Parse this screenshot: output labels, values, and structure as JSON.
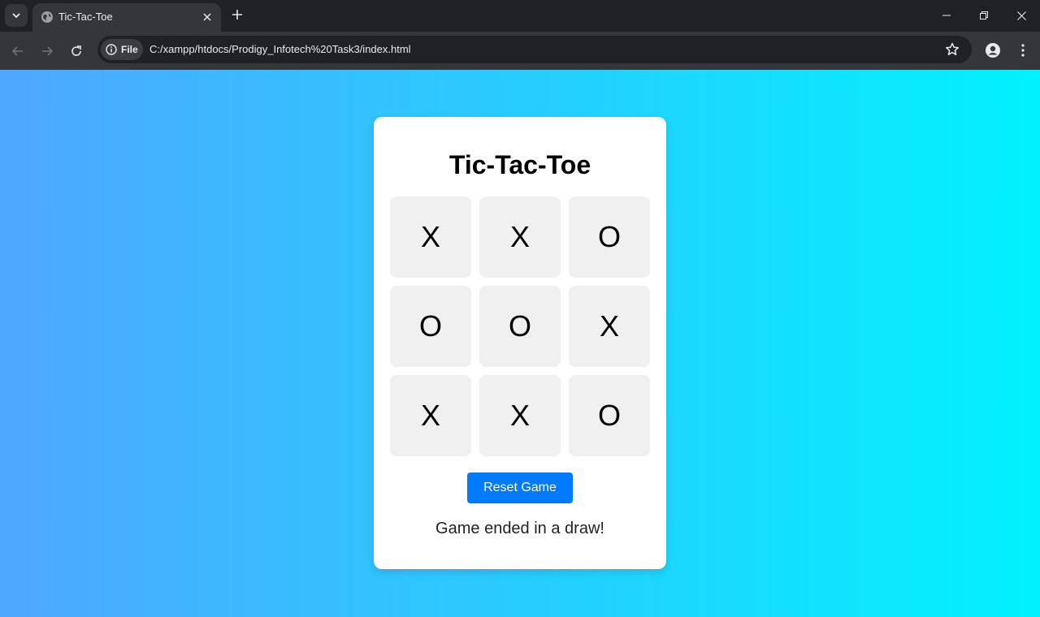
{
  "browser": {
    "tab_title": "Tic-Tac-Toe",
    "chip_label": "File",
    "url": "C:/xampp/htdocs/Prodigy_Infotech%20Task3/index.html"
  },
  "game": {
    "title": "Tic-Tac-Toe",
    "cells": [
      "X",
      "X",
      "O",
      "O",
      "O",
      "X",
      "X",
      "X",
      "O"
    ],
    "reset_label": "Reset Game",
    "status": "Game ended in a draw!"
  },
  "colors": {
    "gradient_start": "#4fa7ff",
    "gradient_end": "#00f2fe",
    "button": "#007bff",
    "cell": "#f0f0f0"
  }
}
